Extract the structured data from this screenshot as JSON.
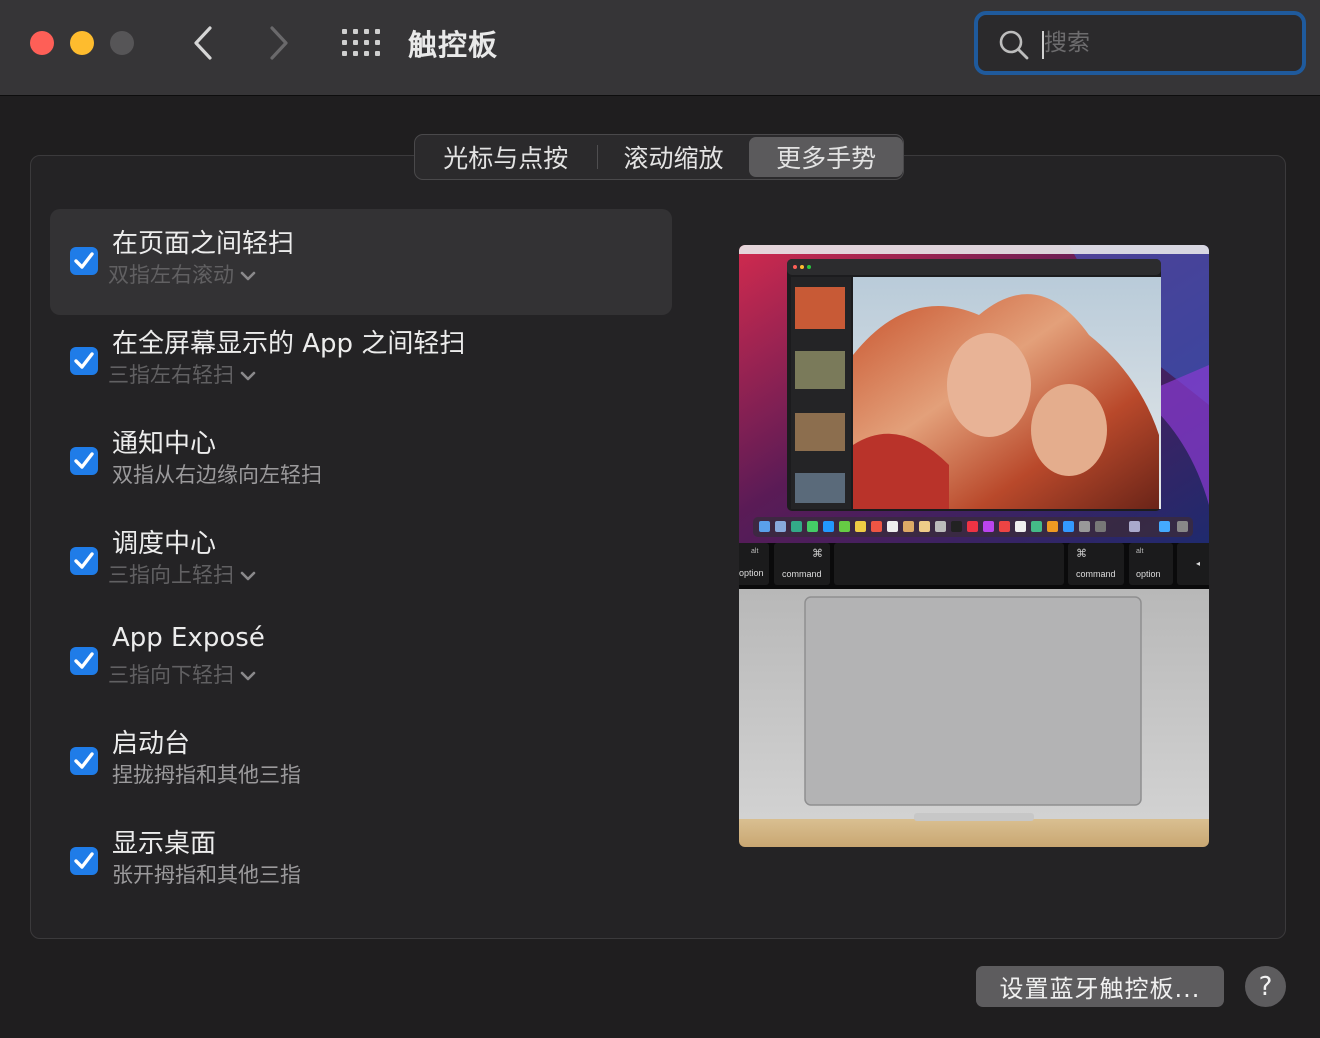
{
  "window": {
    "title": "触控板",
    "search_placeholder": "搜索"
  },
  "tabs": [
    {
      "label": "光标与点按",
      "selected": false
    },
    {
      "label": "滚动缩放",
      "selected": false
    },
    {
      "label": "更多手势",
      "selected": true
    }
  ],
  "gestures": [
    {
      "title": "在页面之间轻扫",
      "subtitle": "双指左右滚动",
      "checked": true,
      "selected": true,
      "has_popup": true
    },
    {
      "title": "在全屏幕显示的 App 之间轻扫",
      "subtitle": "三指左右轻扫",
      "checked": true,
      "selected": false,
      "has_popup": true
    },
    {
      "title": "通知中心",
      "subtitle": "双指从右边缘向左轻扫",
      "checked": true,
      "selected": false,
      "has_popup": false
    },
    {
      "title": "调度中心",
      "subtitle": "三指向上轻扫",
      "checked": true,
      "selected": false,
      "has_popup": true
    },
    {
      "title": "App Exposé",
      "subtitle": "三指向下轻扫",
      "checked": true,
      "selected": false,
      "has_popup": true
    },
    {
      "title": "启动台",
      "subtitle": "捏拢拇指和其他三指",
      "checked": true,
      "selected": false,
      "has_popup": false
    },
    {
      "title": "显示桌面",
      "subtitle": "张开拇指和其他三指",
      "checked": true,
      "selected": false,
      "has_popup": false
    }
  ],
  "preview": {
    "keys": {
      "alt": "alt",
      "option": "option",
      "command_symbol": "⌘",
      "command": "command",
      "right_arrow": "◂"
    }
  },
  "buttons": {
    "bluetooth": "设置蓝牙触控板...",
    "help": "?"
  },
  "colors": {
    "accent": "#1f7ce8",
    "close": "#fe5f57",
    "minimize": "#febc2e",
    "search_focus": "#1f5a9c"
  }
}
